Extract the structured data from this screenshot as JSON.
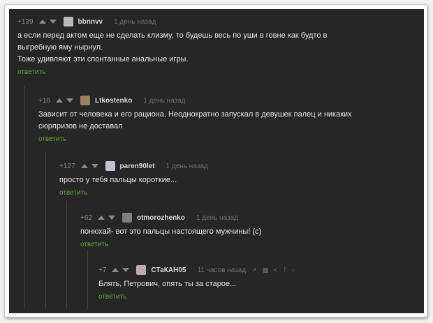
{
  "comments": [
    {
      "rating": "+139",
      "author": "bbnnvv",
      "time": "1 день назад",
      "lines": [
        "а если перед актом еще не сделать клизму, то будешь весь по уши в говне как будто в",
        "выгребную яму нырнул.",
        "Тоже удивляют эти спонтанные анальные игры."
      ],
      "reply_label": "ответить",
      "avatar_color": "#b9b9b9"
    },
    {
      "rating": "+16",
      "author": "Ltkostenko",
      "time": "1 день назад",
      "lines": [
        "Зависит от человека и его рациона. Неоднократно запускал в девушек палец и никаких",
        "сюрпризов не доставал"
      ],
      "reply_label": "ответить",
      "avatar_color": "#9c8060"
    },
    {
      "rating": "+127",
      "author": "paren90let",
      "time": "1 день назад",
      "lines": [
        "просто у тебя пальцы короткие..."
      ],
      "reply_label": "ответить",
      "avatar_color": "#c9bdd4"
    },
    {
      "rating": "+62",
      "author": "otmorozhenko",
      "time": "1 день назад",
      "lines": [
        "понюхай- вот это пальцы настоящего мужчины! (с)"
      ],
      "reply_label": "ответить",
      "avatar_color": "#7f7f7f"
    },
    {
      "rating": "+7",
      "author": "СТаКАН05",
      "time": "11 часов назад",
      "lines": [
        "Блять, Петрович, опять ты за старое..."
      ],
      "reply_label": "ответить",
      "avatar_color": "#c8a8a8",
      "tools": [
        "link-icon",
        "save-icon",
        "share-icon",
        "bookmark-icon",
        "more-icon"
      ]
    }
  ],
  "colors": {
    "background": "#262626",
    "reply_link": "#69a62c",
    "text": "#e6e6e6",
    "meta": "#8a8a8a"
  }
}
